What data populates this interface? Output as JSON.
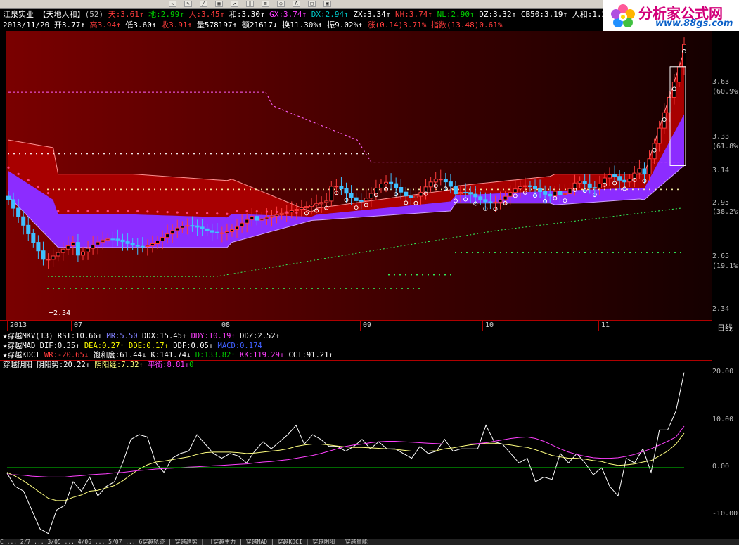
{
  "toolbar": {
    "icons": [
      "arrow-icon",
      "pencil-icon",
      "line-icon",
      "grid-icon",
      "ray-icon",
      "channel-icon",
      "fib-icon",
      "circle-icon",
      "text-icon",
      "rect-icon",
      "save-icon"
    ]
  },
  "info": {
    "line1": [
      {
        "text": "江泉实业",
        "color": "#ffffff"
      },
      {
        "text": " 【天地人和】",
        "color": "#ffffff"
      },
      {
        "text": "(52)",
        "color": "#c0c0c0"
      },
      {
        "text": " 天:3.61↑",
        "color": "#ff3c3c"
      },
      {
        "text": " 地:2.99↑",
        "color": "#00d000"
      },
      {
        "text": " 人:3.45↑",
        "color": "#ff3c3c"
      },
      {
        "text": " 和:3.30↑",
        "color": "#ffffff"
      },
      {
        "text": " GX:3.74↑",
        "color": "#ff3cff"
      },
      {
        "text": " DX:2.94↑",
        "color": "#00c8c8"
      },
      {
        "text": " ZX:3.34↑",
        "color": "#ffffff"
      },
      {
        "text": " NH:3.74↑",
        "color": "#ff3c3c"
      },
      {
        "text": " NL:2.90↑",
        "color": "#00d000"
      },
      {
        "text": " DZ:3.32↑",
        "color": "#ffffff"
      },
      {
        "text": " CB50:3.19↑",
        "color": "#ffffff"
      },
      {
        "text": " 人和:1.26↑",
        "color": "#ffffff"
      },
      {
        "text": " 天和",
        "color": "#4060ff"
      }
    ],
    "line2": [
      {
        "text": "2013/11/20",
        "color": "#ffffff"
      },
      {
        "text": " 开3.77↑",
        "color": "#ffffff"
      },
      {
        "text": " 高3.94↑",
        "color": "#ff3c3c"
      },
      {
        "text": " 低3.60↑",
        "color": "#ffffff"
      },
      {
        "text": " 收3.91↑",
        "color": "#ff3c3c"
      },
      {
        "text": " 量578197↑",
        "color": "#ffffff"
      },
      {
        "text": " 额21617↓",
        "color": "#ffffff"
      },
      {
        "text": " 换11.30%↑",
        "color": "#ffffff"
      },
      {
        "text": " 振9.02%↑",
        "color": "#ffffff"
      },
      {
        "text": " 涨(0.14)3.71%",
        "color": "#ff3c3c"
      },
      {
        "text": " 指数(13.48)0.61%",
        "color": "#ff3c3c"
      }
    ]
  },
  "logo": {
    "title": "分析家公式网",
    "url": "www.88gs.com"
  },
  "price_axis": [
    {
      "label": "3.63",
      "y": 118
    },
    {
      "label": "(60.9%)",
      "y": 132
    },
    {
      "label": "3.33",
      "y": 196
    },
    {
      "label": "(61.8%)",
      "y": 210
    },
    {
      "label": "3.14",
      "y": 244
    },
    {
      "label": "2.95",
      "y": 290
    },
    {
      "label": "(38.2%)",
      "y": 303
    },
    {
      "label": "2.65",
      "y": 366
    },
    {
      "label": "(19.1%)",
      "y": 380
    },
    {
      "label": "2.34",
      "y": 441
    }
  ],
  "low_marker": "2.34",
  "dates": [
    {
      "label": "2013",
      "x": 14
    },
    {
      "label": "07",
      "x": 105
    },
    {
      "label": "08",
      "x": 315
    },
    {
      "label": "09",
      "x": 516
    },
    {
      "label": "10",
      "x": 690
    },
    {
      "label": "11",
      "x": 855
    }
  ],
  "period_label": "日线",
  "indicators": [
    [
      {
        "text": "★穿越MKV(13)",
        "color": "#ffffff"
      },
      {
        "text": " RSI:10.66↑",
        "color": "#ffffff"
      },
      {
        "text": " MR:5.50",
        "color": "#8080ff"
      },
      {
        "text": " DDX:15.45↑",
        "color": "#ffffff"
      },
      {
        "text": " DDY:10.19↑",
        "color": "#ff40ff"
      },
      {
        "text": " DDZ:2.52↑",
        "color": "#ffffff"
      }
    ],
    [
      {
        "text": "★穿越MAD",
        "color": "#ffffff"
      },
      {
        "text": " DIF:0.35↑",
        "color": "#ffffff"
      },
      {
        "text": " DEA:0.27↑",
        "color": "#ffff00"
      },
      {
        "text": " DDE:0.17↑",
        "color": "#ffff00"
      },
      {
        "text": " DDF:0.05↑",
        "color": "#ffffff"
      },
      {
        "text": " MACD:0.174",
        "color": "#4060ff"
      }
    ],
    [
      {
        "text": "★穿越KDCI",
        "color": "#ffffff"
      },
      {
        "text": " WR:-20.65↓",
        "color": "#ff3c3c"
      },
      {
        "text": " 饱和度:61.44↓",
        "color": "#ffffff"
      },
      {
        "text": " K:141.74↓",
        "color": "#ffffff"
      },
      {
        "text": " D:133.82↑",
        "color": "#00d000"
      },
      {
        "text": " KK:119.29↑",
        "color": "#ff40ff"
      },
      {
        "text": " CCI:91.21↑",
        "color": "#ffffff"
      }
    ],
    [
      {
        "text": "穿越阴阳",
        "color": "#ffffff"
      },
      {
        "text": "  阴阳势:20.22↑",
        "color": "#ffffff"
      },
      {
        "text": " 阴阳经:7.32↑",
        "color": "#ffff80"
      },
      {
        "text": " 平衡:8.81↑",
        "color": "#ff40ff"
      },
      {
        "text": "0",
        "color": "#00d000"
      }
    ]
  ],
  "osc_axis": [
    {
      "label": "20.00",
      "y": 530
    },
    {
      "label": "10.00",
      "y": 598
    },
    {
      "label": "0.00",
      "y": 665
    },
    {
      "label": "-10.00",
      "y": 732
    }
  ],
  "status_text": "C ... 2/7 ... 3/05 ... 4/06 ... 5/07 ... 6穿越轨迹 | 穿越趋势 | 【穿越主力 | 穿越MAD | 穿越KDCI | 穿越阴阳 | 穿越量能",
  "chart_data": {
    "type": "line",
    "title": "江泉实业 天地人和",
    "price_range": [
      2.34,
      3.94
    ],
    "last_close": 3.91,
    "oscillator": {
      "y_range": [
        -13,
        22
      ],
      "series": [
        {
          "name": "阴阳势",
          "color": "#ffffff",
          "values": [
            -1.2,
            -4,
            -5,
            -9,
            -13,
            -14,
            -9,
            -8,
            -3,
            -5,
            -2,
            -6,
            -4,
            -3,
            1,
            6,
            7,
            6.5,
            1,
            -1,
            2,
            3,
            3.5,
            7,
            5,
            3,
            2,
            3,
            2.5,
            1,
            3.5,
            5.5,
            4,
            5.5,
            7,
            9,
            5,
            7,
            6,
            4.5,
            4.5,
            3.5,
            4.5,
            6,
            4,
            5.5,
            4,
            4,
            3,
            2,
            4.5,
            3,
            3.5,
            6,
            3.5,
            4,
            4,
            4,
            9,
            5.5,
            5,
            3,
            1,
            2,
            -3,
            -2,
            -2.5,
            3,
            1,
            3,
            1,
            -1.5,
            0,
            -4,
            -6,
            2,
            1,
            4,
            -1,
            8,
            8,
            12,
            20.2
          ]
        },
        {
          "name": "阴阳经",
          "color": "#ffff80",
          "values": [
            -1,
            -1.8,
            -2.8,
            -4,
            -5.3,
            -6.5,
            -7,
            -7,
            -6.3,
            -5.8,
            -5,
            -4.8,
            -4.3,
            -3.8,
            -2.8,
            -1.5,
            -0.3,
            0.6,
            1.2,
            1.4,
            1.7,
            2,
            2.3,
            2.8,
            3.2,
            3.3,
            3.3,
            3.3,
            3.2,
            3,
            3.1,
            3.3,
            3.5,
            3.7,
            4,
            4.5,
            4.8,
            5,
            5,
            4.8,
            4.6,
            4.4,
            4.3,
            4.3,
            4.2,
            4.1,
            4,
            3.9,
            3.7,
            3.5,
            3.5,
            3.5,
            3.6,
            4,
            4.2,
            4.5,
            4.8,
            5,
            5.2,
            5.2,
            5,
            4.8,
            4.5,
            4.3,
            3.8,
            3.2,
            2.6,
            2.3,
            2,
            2,
            1.8,
            1.5,
            1.3,
            0.8,
            0.5,
            0.6,
            0.8,
            1.2,
            1.5,
            2.5,
            3.5,
            5,
            7.32
          ]
        },
        {
          "name": "平衡",
          "color": "#ff40ff",
          "values": [
            -1.5,
            -1.5,
            -1.6,
            -1.8,
            -1.9,
            -2,
            -2,
            -2,
            -1.8,
            -1.7,
            -1.5,
            -1.4,
            -1.3,
            -1.1,
            -1,
            -0.8,
            -0.6,
            -0.5,
            -0.3,
            -0.2,
            -0.1,
            0,
            0.1,
            0.2,
            0.3,
            0.4,
            0.5,
            0.6,
            0.7,
            0.8,
            1,
            1.2,
            1.3,
            1.5,
            1.7,
            2,
            2.3,
            2.6,
            3,
            3.5,
            4,
            4.5,
            4.8,
            5,
            5.3,
            5.5,
            5.6,
            5.6,
            5.5,
            5.4,
            5.3,
            5.2,
            5.1,
            5,
            5,
            5,
            5,
            5.1,
            5.3,
            5.6,
            5.9,
            6.2,
            6.4,
            6.5,
            6.2,
            5.6,
            4.8,
            4,
            3.3,
            2.8,
            2.4,
            2.1,
            2,
            2,
            2.1,
            2.4,
            2.8,
            3.4,
            4,
            4.8,
            5.6,
            6.5,
            8.81
          ]
        },
        {
          "name": "零线",
          "color": "#00d000",
          "values": [
            0,
            0
          ]
        }
      ]
    }
  }
}
